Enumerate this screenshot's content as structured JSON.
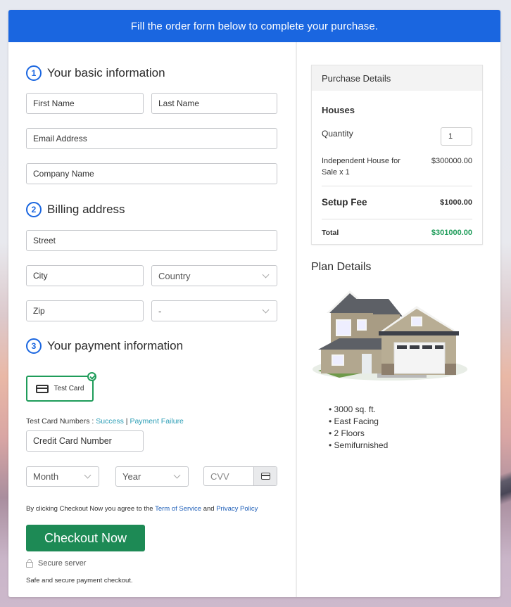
{
  "banner": {
    "text": "Fill the order form below to complete your purchase."
  },
  "sections": {
    "basic": {
      "num": "1",
      "title": "Your basic information"
    },
    "billing": {
      "num": "2",
      "title": "Billing address"
    },
    "payment": {
      "num": "3",
      "title": "Your payment information"
    }
  },
  "fields": {
    "first_name": "First Name",
    "last_name": "Last Name",
    "email": "Email Address",
    "company": "Company Name",
    "street": "Street",
    "city": "City",
    "country": "Country",
    "zip": "Zip",
    "state": "-",
    "card_number": "Credit Card Number",
    "month": "Month",
    "year": "Year",
    "cvv": "CVV"
  },
  "payment": {
    "method_label": "Test Card",
    "test_numbers_label": "Test Card Numbers : ",
    "success_link": "Success",
    "separator": " | ",
    "failure_link": "Payment Failure"
  },
  "agreement": {
    "prefix": "By clicking Checkout Now you agree to the ",
    "tos": "Term of Service",
    "and": " and ",
    "privacy": "Privacy Policy"
  },
  "checkout": {
    "button": "Checkout Now",
    "secure": "Secure server",
    "safe": "Safe and secure payment checkout."
  },
  "purchase": {
    "header": "Purchase Details",
    "product_group": "Houses",
    "quantity_label": "Quantity",
    "quantity_value": "1",
    "item_name": "Independent House for Sale x 1",
    "item_price": "$300000.00",
    "setup_fee_label": "Setup Fee",
    "setup_fee_value": "$1000.00",
    "total_label": "Total",
    "total_value": "$301000.00",
    "total_color": "#1f9c5a"
  },
  "plan": {
    "title": "Plan Details",
    "features": [
      "3000 sq. ft.",
      "East Facing",
      "2 Floors",
      "Semifurnished"
    ]
  },
  "colors": {
    "brand": "#1a66e0",
    "checkout": "#1d8a55",
    "accent_green": "#1f9c5a"
  }
}
